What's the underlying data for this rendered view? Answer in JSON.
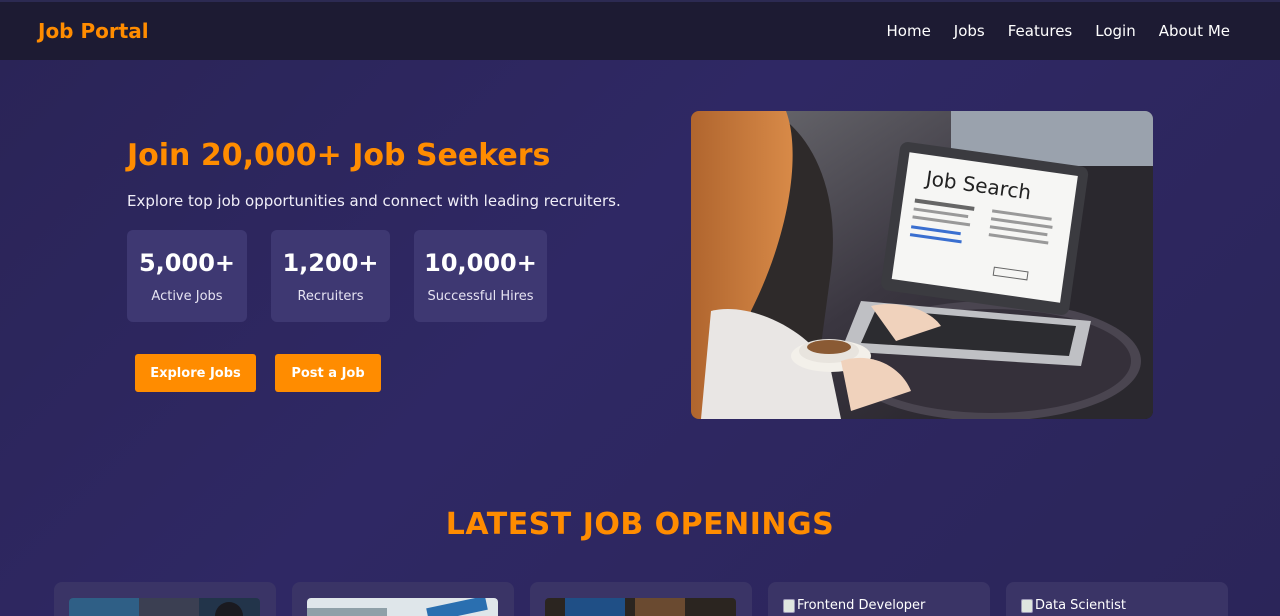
{
  "nav": {
    "brand": "Job Portal",
    "links": [
      "Home",
      "Jobs",
      "Features",
      "Login",
      "About Me"
    ]
  },
  "hero": {
    "title": "Join 20,000+ Job Seekers",
    "subtitle": "Explore top job opportunities and connect with leading recruiters.",
    "stats": [
      {
        "value": "5,000+",
        "label": "Active Jobs"
      },
      {
        "value": "1,200+",
        "label": "Recruiters"
      },
      {
        "value": "10,000+",
        "label": "Successful Hires"
      }
    ],
    "buttons": {
      "explore": "Explore Jobs",
      "post": "Post a Job"
    },
    "image_alt": "Job Search"
  },
  "jobs": {
    "heading": "LATEST JOB OPENINGS",
    "cards": [
      {
        "alt": ""
      },
      {
        "alt": ""
      },
      {
        "alt": ""
      },
      {
        "alt": "Frontend Developer"
      },
      {
        "alt": "Data Scientist"
      }
    ]
  },
  "colors": {
    "accent": "#ff8c00",
    "navbar": "#1d1b33",
    "card": "#3a3466"
  }
}
